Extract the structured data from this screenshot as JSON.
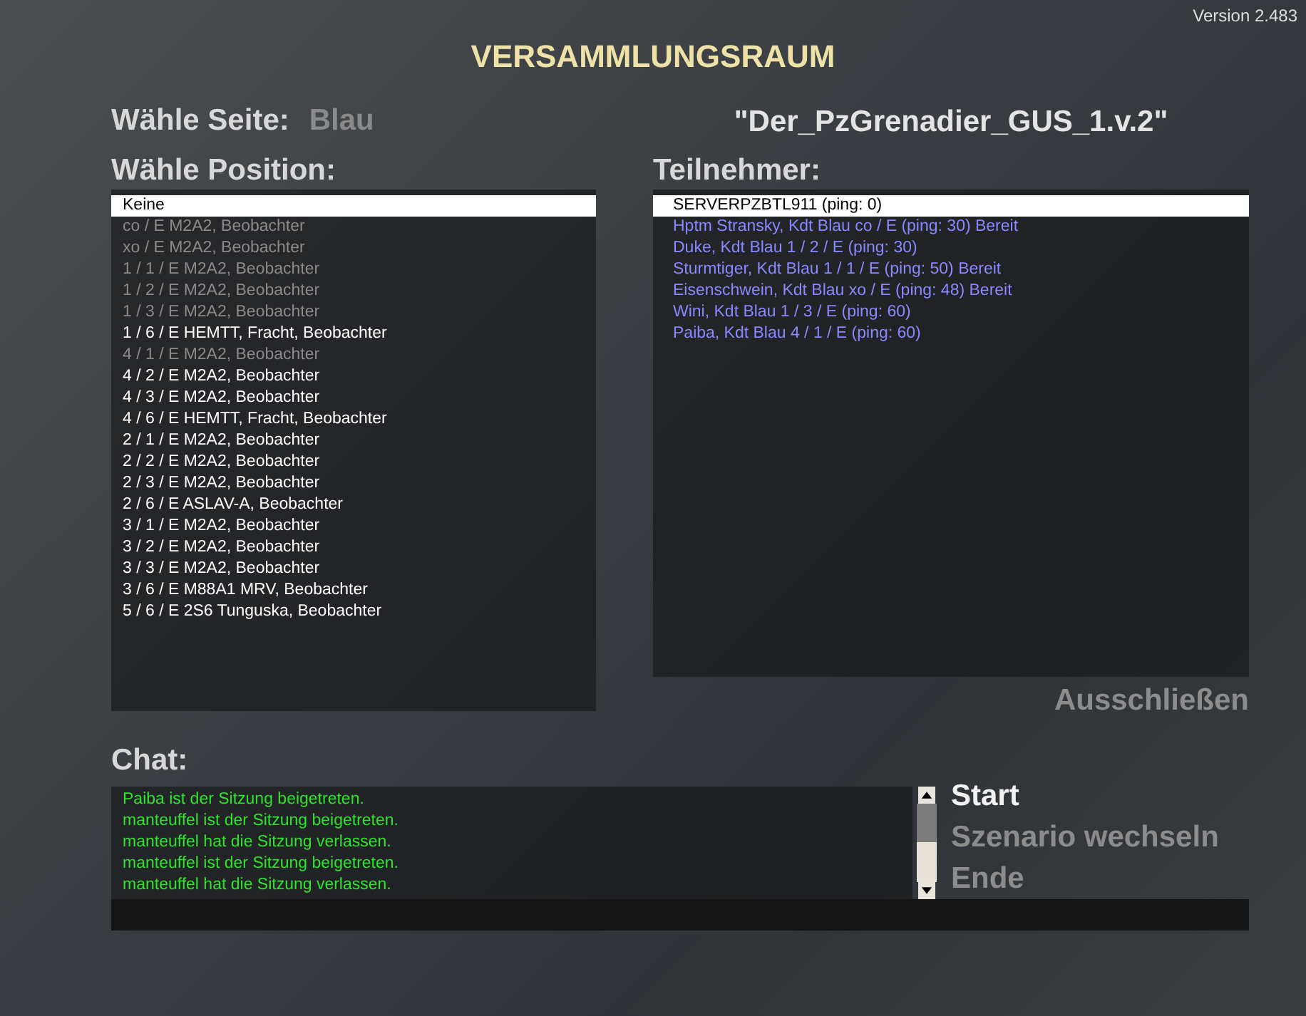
{
  "version": "Version 2.483",
  "title": "VERSAMMLUNGSRAUM",
  "side": {
    "label": "Wähle Seite:",
    "value": "Blau"
  },
  "mission": "\"Der_PzGrenadier_GUS_1.v.2\"",
  "positions": {
    "label": "Wähle Position:",
    "items": [
      {
        "text": "Keine",
        "selected": true,
        "disabled": false
      },
      {
        "text": "co / E  M2A2,  Beobachter",
        "selected": false,
        "disabled": true
      },
      {
        "text": "xo / E  M2A2,  Beobachter",
        "selected": false,
        "disabled": true
      },
      {
        "text": "1 / 1 / E  M2A2,  Beobachter",
        "selected": false,
        "disabled": true
      },
      {
        "text": "1 / 2 / E  M2A2,  Beobachter",
        "selected": false,
        "disabled": true
      },
      {
        "text": "1 / 3 / E  M2A2,  Beobachter",
        "selected": false,
        "disabled": true
      },
      {
        "text": "1 / 6 / E  HEMTT, Fracht,  Beobachter",
        "selected": false,
        "disabled": false
      },
      {
        "text": "4 / 1 / E  M2A2,  Beobachter",
        "selected": false,
        "disabled": true
      },
      {
        "text": "4 / 2 / E  M2A2,  Beobachter",
        "selected": false,
        "disabled": false
      },
      {
        "text": "4 / 3 / E  M2A2,  Beobachter",
        "selected": false,
        "disabled": false
      },
      {
        "text": "4 / 6 / E  HEMTT, Fracht,  Beobachter",
        "selected": false,
        "disabled": false
      },
      {
        "text": "2 / 1 / E  M2A2,  Beobachter",
        "selected": false,
        "disabled": false
      },
      {
        "text": "2 / 2 / E  M2A2,  Beobachter",
        "selected": false,
        "disabled": false
      },
      {
        "text": "2 / 3 / E  M2A2,  Beobachter",
        "selected": false,
        "disabled": false
      },
      {
        "text": "2 / 6 / E  ASLAV-A,  Beobachter",
        "selected": false,
        "disabled": false
      },
      {
        "text": "3 / 1 / E  M2A2,  Beobachter",
        "selected": false,
        "disabled": false
      },
      {
        "text": "3 / 2 / E  M2A2,  Beobachter",
        "selected": false,
        "disabled": false
      },
      {
        "text": "3 / 3 / E  M2A2,  Beobachter",
        "selected": false,
        "disabled": false
      },
      {
        "text": "3 / 6 / E  M88A1 MRV,  Beobachter",
        "selected": false,
        "disabled": false
      },
      {
        "text": "5 / 6 / E  2S6 Tunguska,  Beobachter",
        "selected": false,
        "disabled": false
      }
    ]
  },
  "participants": {
    "label": "Teilnehmer:",
    "items": [
      {
        "text": "SERVERPZBTL911  (ping: 0)",
        "selected": true
      },
      {
        "text": "Hptm Stransky,  Kdt Blau  co / E  (ping: 30)  Bereit",
        "selected": false
      },
      {
        "text": "Duke,  Kdt Blau  1 / 2 / E  (ping: 30)",
        "selected": false
      },
      {
        "text": "Sturmtiger,  Kdt Blau  1 / 1 / E  (ping: 50)  Bereit",
        "selected": false
      },
      {
        "text": "Eisenschwein,  Kdt Blau  xo / E  (ping: 48)  Bereit",
        "selected": false
      },
      {
        "text": "Wini,  Kdt Blau  1 / 3 / E  (ping: 60)",
        "selected": false
      },
      {
        "text": "Paiba,  Kdt Blau  4 / 1 / E  (ping: 60)",
        "selected": false
      }
    ]
  },
  "kick_button": {
    "label": "Ausschließen",
    "disabled": true
  },
  "chat": {
    "label": "Chat:",
    "messages": [
      "Paiba ist der Sitzung beigetreten.",
      "manteuffel ist der Sitzung beigetreten.",
      "manteuffel hat die Sitzung verlassen.",
      "manteuffel ist der Sitzung beigetreten.",
      "manteuffel hat die Sitzung verlassen."
    ]
  },
  "menu": [
    {
      "label": "Start",
      "disabled": false
    },
    {
      "label": "Szenario wechseln",
      "disabled": true
    },
    {
      "label": "Ende",
      "disabled": true
    }
  ]
}
